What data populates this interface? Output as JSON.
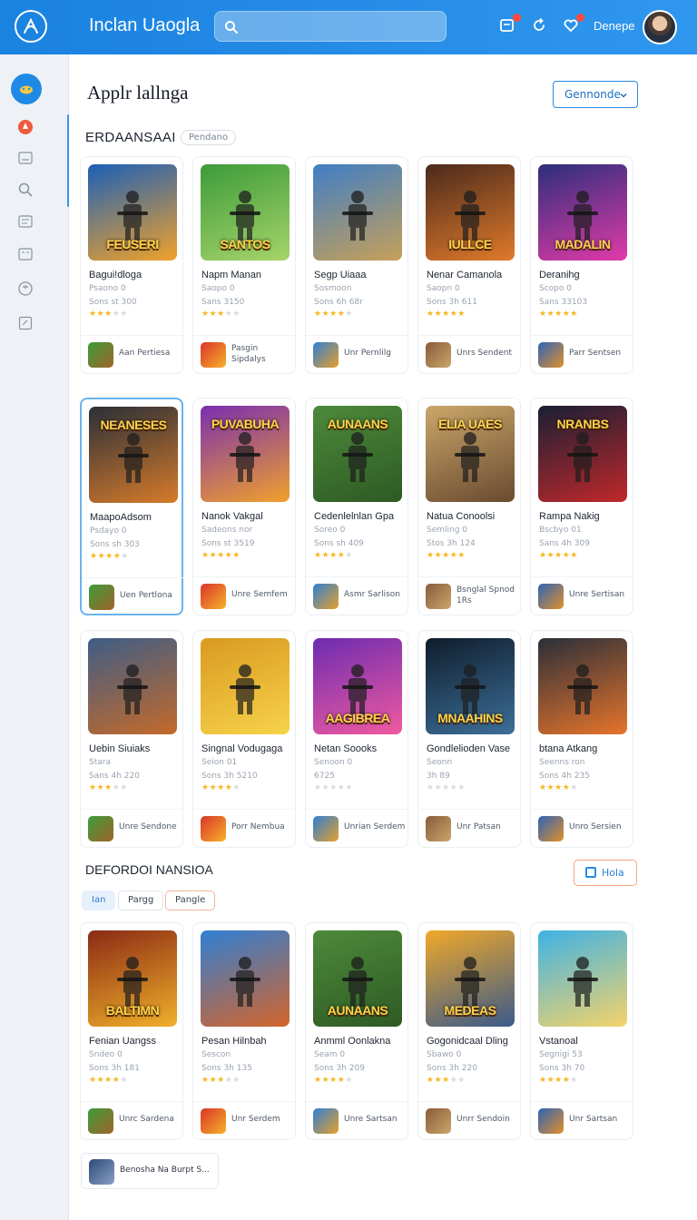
{
  "header": {
    "app_title": "Inclan Uaogla",
    "search_placeholder": "",
    "username": "Denepe"
  },
  "page": {
    "title": "Applr lallnga",
    "dropdown_value": "Gennonde",
    "section_title": "ERDAANSAAI",
    "section_pill": "Pendano"
  },
  "rows": [
    [
      {
        "title": "Bagui!dloga",
        "sub": "Psaono 0",
        "meta": "Sons st 300",
        "stars": 3,
        "caption": "FEUSERI",
        "action": "Aan Pertiesa"
      },
      {
        "title": "Napm Manan",
        "sub": "Saopo 0",
        "meta": "Sans 3150",
        "stars": 3,
        "caption": "SANTOS",
        "action": "Pasgin Sipdalys"
      },
      {
        "title": "Segp Uiaaa",
        "sub": "Sosmoon",
        "meta": "Sons 6h 68r",
        "stars": 4,
        "caption": "",
        "action": "Unr Pernlilg"
      },
      {
        "title": "Nenar Camanola",
        "sub": "Saopn 0",
        "meta": "Sons 3h 611",
        "stars": 5,
        "caption": "IULLCE",
        "action": "Unrs Sendent"
      },
      {
        "title": "Deranihg",
        "sub": "Scopo 0",
        "meta": "Sans 33103",
        "stars": 5,
        "caption": "MADALIN",
        "action": "Parr Sentsen"
      }
    ],
    [
      {
        "title": "MaapoAdsom",
        "sub": "Psdayo 0",
        "meta": "Sons sh 303",
        "stars": 4,
        "caption": "NEANESES",
        "action": "Uen Pertlona"
      },
      {
        "title": "Nanok Vakgal",
        "sub": "Sadeons nor",
        "meta": "Sons st 3519",
        "stars": 5,
        "caption": "PUVABUHA",
        "action": "Unre Semfem"
      },
      {
        "title": "Cedenlelnlan Gpa",
        "sub": "Soreo 0",
        "meta": "Sons sh 409",
        "stars": 4,
        "caption": "AUNAANS",
        "action": "Asmr Sarlison"
      },
      {
        "title": "Natua Conoolsi",
        "sub": "Semling 0",
        "meta": "Stos 3h 124",
        "stars": 5,
        "caption": "ELIA UAES",
        "action": "Bsnglal Spnod 1Rs"
      },
      {
        "title": "Rampa Nakig",
        "sub": "Bscbyo 01",
        "meta": "Sans 4h 309",
        "stars": 5,
        "caption": "NRANBS",
        "action": "Unre Sertisan"
      }
    ],
    [
      {
        "title": "Uebin Siuiaks",
        "sub": "Stara",
        "meta": "Sans 4h 220",
        "stars": 3,
        "caption": "",
        "action": "Unre Sendone"
      },
      {
        "title": "Singnal Vodugaga",
        "sub": "Seion 01",
        "meta": "Sons 3h 5210",
        "stars": 4,
        "caption": "",
        "action": "Porr Nembua"
      },
      {
        "title": "Netan Soooks",
        "sub": "Senoon 0",
        "meta": "6725",
        "stars": 0,
        "caption": "AAGIBREA",
        "action": "Unrian Serdem"
      },
      {
        "title": "Gondlelioden Vase",
        "sub": "Seonn",
        "meta": "3h 89",
        "stars": 0,
        "caption": "MNAAHINS",
        "action": "Unr Patsan"
      },
      {
        "title": "btana Atkang",
        "sub": "Seenns ron",
        "meta": "Sons 4h 235",
        "stars": 4,
        "caption": "",
        "action": "Unro Sersien"
      }
    ],
    [
      {
        "title": "Fenian Uangss",
        "sub": "Sndeo 0",
        "meta": "Sons 3h 181",
        "stars": 4,
        "caption": "BALTIMN",
        "action": "Unrc Sardena"
      },
      {
        "title": "Pesan Hilnbah",
        "sub": "Sescon",
        "meta": "Sons 3h 135",
        "stars": 3,
        "caption": "",
        "action": "Unr Serdem"
      },
      {
        "title": "Anmml Oonlakna",
        "sub": "Seam 0",
        "meta": "Sons 3h 209",
        "stars": 4,
        "caption": "AUNAANS",
        "action": "Unre Sartsan"
      },
      {
        "title": "Gogonidcaal Dling",
        "sub": "Sbawo 0",
        "meta": "Sons 3h 220",
        "stars": 3,
        "caption": "MEDEAS",
        "action": "Unrr Sendoin"
      },
      {
        "title": "Vstanoal",
        "sub": "Segnigi 53",
        "meta": "Sons 3h 70",
        "stars": 4,
        "caption": "",
        "action": "Unr Sartsan"
      }
    ]
  ],
  "section2": {
    "title": "DEFORDOI NANSIOA",
    "chips": [
      "Ian",
      "Pargg",
      "Pangle"
    ],
    "help_label": "Hola"
  },
  "footer_tile": {
    "label": "Benosha Na Burpt S..."
  },
  "colors": {
    "accent": "#1f8ae5",
    "star": "#f5b723",
    "help_border": "#f3a57a"
  }
}
